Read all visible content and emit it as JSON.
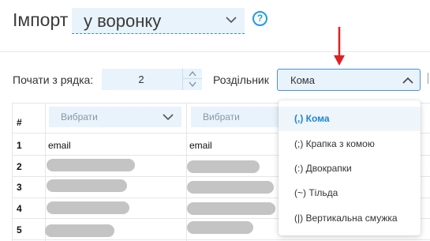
{
  "header": {
    "title": "Імпорт",
    "funnel_value": "у воронку",
    "help_glyph": "?"
  },
  "settings": {
    "start_row_label": "Почати з рядка:",
    "start_row_value": "2",
    "delimiter_label": "Роздільник",
    "delimiter_value": "Кома"
  },
  "table": {
    "headers": [
      "#"
    ],
    "column_selects": [
      "Вибрати",
      "Вибрати"
    ],
    "header_row": {
      "num": "1",
      "cells": [
        "email",
        "email"
      ]
    },
    "row_numbers": [
      "2",
      "3",
      "4",
      "5"
    ]
  },
  "dropdown": {
    "options": [
      {
        "label": "(,) Кома",
        "selected": true
      },
      {
        "label": "(;) Крапка з комою",
        "selected": false
      },
      {
        "label": "(:) Двокрапки",
        "selected": false
      },
      {
        "label": "(~) Тільда",
        "selected": false
      },
      {
        "label": "(|) Вертикальна смужка",
        "selected": false
      }
    ]
  },
  "colors": {
    "accent": "#1e86d6",
    "select_bg": "#e8f3fc",
    "annotation_arrow": "#e02020"
  }
}
